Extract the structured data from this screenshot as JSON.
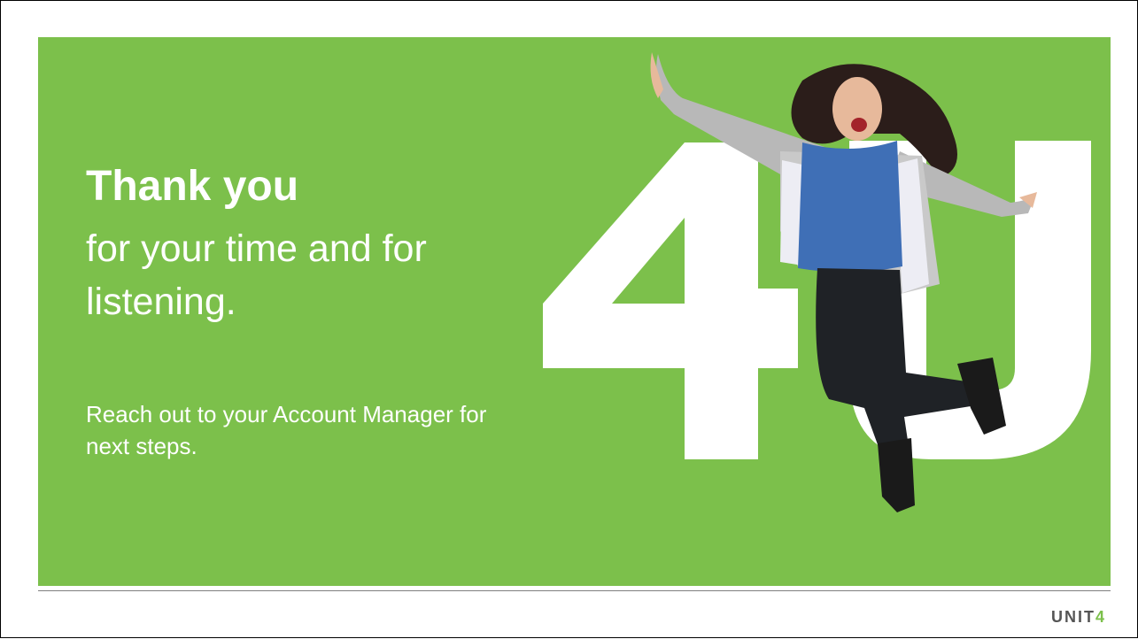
{
  "slide": {
    "headline": "Thank you",
    "subline": "for your time and for listening.",
    "cta": "Reach out to your Account Manager for next steps."
  },
  "graphic": {
    "decor_text": "4U",
    "image_description_icon": "jumping-woman-icon"
  },
  "footer": {
    "logo_prefix": "UNIT",
    "logo_suffix": "4"
  },
  "colors": {
    "green": "#7cc04b",
    "white": "#ffffff",
    "logo_gray": "#555555"
  }
}
